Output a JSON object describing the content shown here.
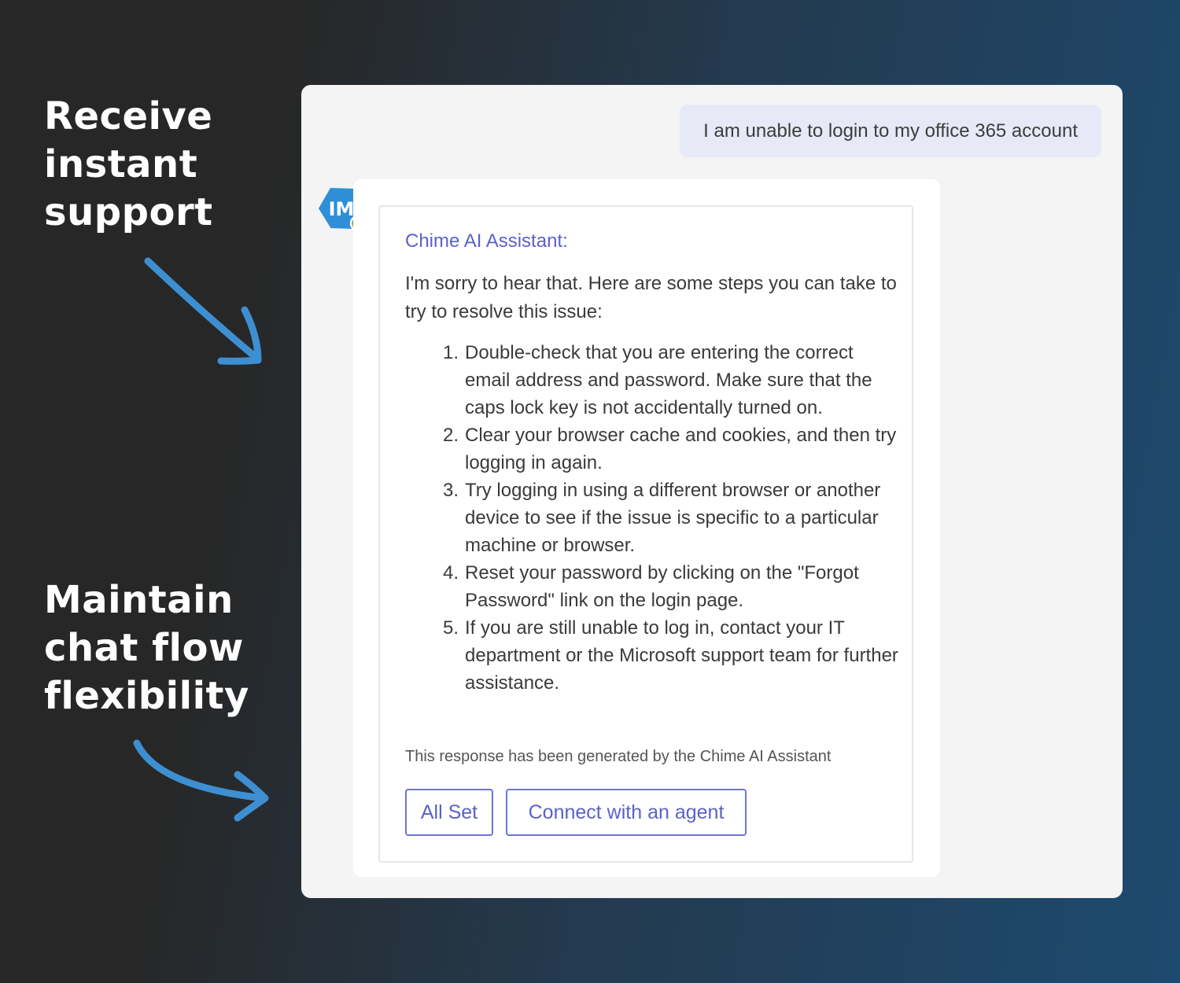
{
  "captions": {
    "top": [
      "Receive",
      "instant",
      "support"
    ],
    "bottom": [
      "Maintain",
      "chat flow",
      "flexibility"
    ]
  },
  "colors": {
    "arrow": "#3d8fd1",
    "accent": "#5b62c7",
    "avatar": "#2f8fd6",
    "online": "#6ab04c"
  },
  "chat": {
    "user_message": "I am unable to login to my office 365 account",
    "bot": {
      "avatar_initials": "IM",
      "status_icon": "check-circle-icon",
      "title": "Chime AI Assistant:",
      "intro": "I'm sorry to hear that. Here are some steps you can take to try to resolve this issue:",
      "steps": [
        {
          "num": "1.",
          "text": "Double-check that you are entering the correct email address and password. Make sure that the caps lock key is not accidentally turned on."
        },
        {
          "num": "2.",
          "text": "Clear your browser cache and cookies, and then try logging in again."
        },
        {
          "num": "3.",
          "text": "Try logging in using a different browser or another device to see if the issue is specific to a particular machine or browser."
        },
        {
          "num": "4.",
          "text": "Reset your password by clicking on the \"Forgot Password\" link on the login page."
        },
        {
          "num": "5.",
          "text": "If you are still unable to log in, contact your IT department or the Microsoft support team for further assistance."
        }
      ],
      "disclaimer": "This response has been generated by the Chime AI Assistant",
      "buttons": {
        "all_set": "All Set",
        "connect": "Connect with an agent"
      }
    }
  }
}
